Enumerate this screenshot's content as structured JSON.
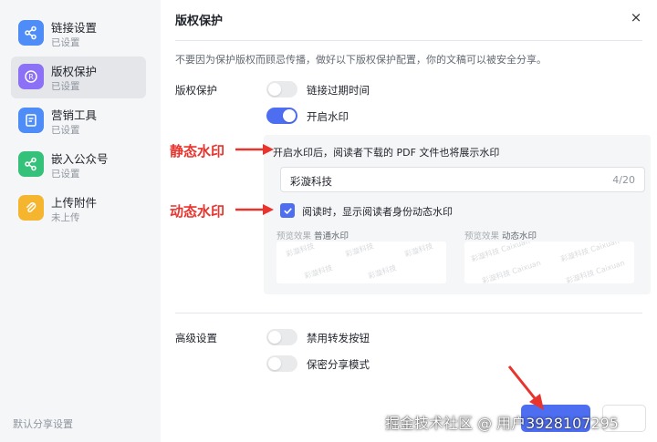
{
  "sidebar": {
    "items": [
      {
        "label": "链接设置",
        "status": "已设置",
        "icon": "share-icon",
        "color": "#4e8cf7"
      },
      {
        "label": "版权保护",
        "status": "已设置",
        "icon": "copyright-icon",
        "color": "#8c70f5"
      },
      {
        "label": "营销工具",
        "status": "已设置",
        "icon": "document-icon",
        "color": "#4e8cf7"
      },
      {
        "label": "嵌入公众号",
        "status": "已设置",
        "icon": "share-icon",
        "color": "#34c27a"
      },
      {
        "label": "上传附件",
        "status": "未上传",
        "icon": "paperclip-icon",
        "color": "#f5b52e"
      }
    ],
    "footer": "默认分享设置"
  },
  "dialog": {
    "title": "版权保护",
    "close_icon": "×",
    "description": "不要因为保护版权而顾忌传播，做好以下版权保护配置，你的文稿可以被安全分享。"
  },
  "copyright": {
    "label": "版权保护",
    "link_expire": {
      "label": "链接过期时间",
      "enabled": false
    },
    "watermark": {
      "label": "开启水印",
      "enabled": true
    }
  },
  "watermark_panel": {
    "note": "开启水印后，阅读者下载的 PDF 文件也将展示水印",
    "input_value": "彩漩科技",
    "counter": "4/20",
    "dynamic_checkbox": {
      "label": "阅读时，显示阅读者身份动态水印",
      "checked": true
    },
    "preview_prefix": "预览效果",
    "preview_normal": "普通水印",
    "preview_dynamic": "动态水印",
    "ghost_text": "彩漩科技",
    "ghost_text_dynamic": "彩漩科技 Caixuan"
  },
  "advanced": {
    "label": "高级设置",
    "disable_forward": {
      "label": "禁用转发按钮",
      "enabled": false
    },
    "private_share": {
      "label": "保密分享模式",
      "enabled": false
    }
  },
  "annotations": {
    "static": "静态水印",
    "dynamic": "动态水印",
    "color": "#e8342e"
  },
  "site_watermark": "掘金技术社区 @ 用户3928107295",
  "accent": "#4e6ef2"
}
